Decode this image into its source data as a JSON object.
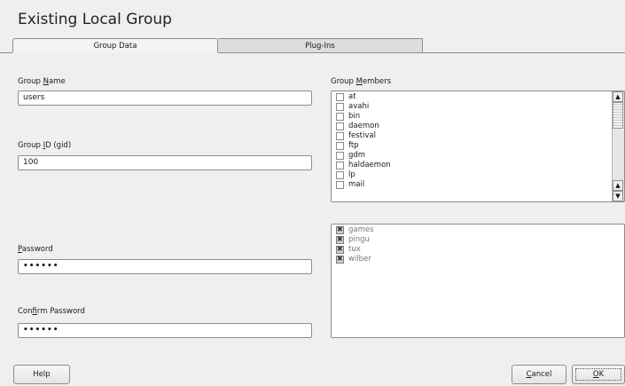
{
  "window": {
    "title": "Existing Local Group"
  },
  "tabs": [
    {
      "label": "Group Data",
      "active": true
    },
    {
      "label": "Plug-Ins",
      "active": false
    }
  ],
  "form": {
    "group_name": {
      "label_pre": "Group ",
      "label_ul": "N",
      "label_post": "ame",
      "value": "users"
    },
    "group_id": {
      "label_pre": "Group ",
      "label_ul": "I",
      "label_post": "D (gid)",
      "value": "100"
    },
    "password": {
      "label_pre": "",
      "label_ul": "P",
      "label_post": "assword",
      "value": "••••••"
    },
    "confirm_password": {
      "label_pre": "Con",
      "label_ul": "f",
      "label_post": "irm Password",
      "value": "••••••"
    }
  },
  "group_members": {
    "label_pre": "Group ",
    "label_ul": "M",
    "label_post": "embers",
    "items": [
      "at",
      "avahi",
      "bin",
      "daemon",
      "festival",
      "ftp",
      "gdm",
      "haldaemon",
      "lp",
      "mail"
    ]
  },
  "more_users": {
    "items": [
      "games",
      "pingu",
      "tux",
      "wilber"
    ]
  },
  "buttons": {
    "help": "Help",
    "cancel_ul": "C",
    "cancel_rest": "ancel",
    "ok_ul": "O",
    "ok_rest": "K"
  }
}
